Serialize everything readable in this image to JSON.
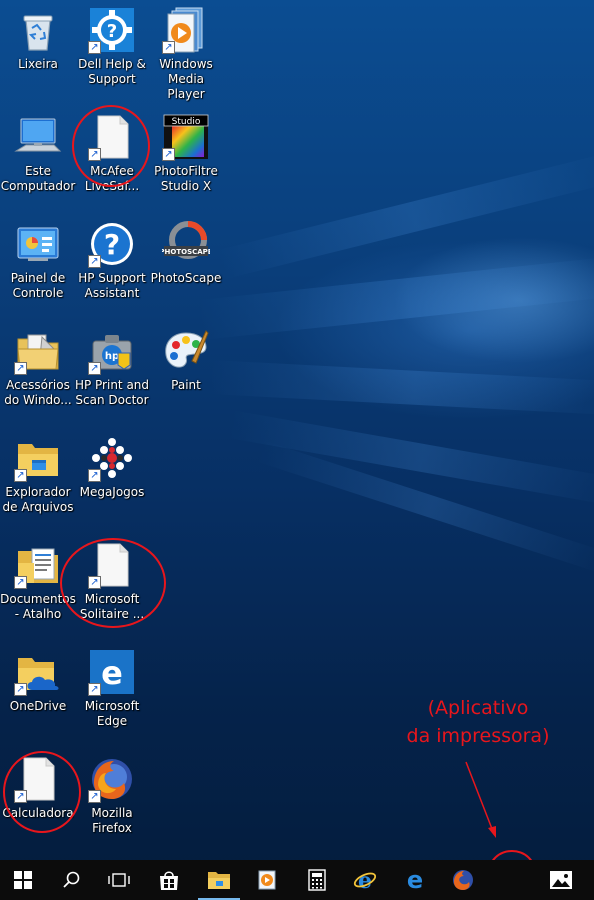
{
  "desktop": {
    "icons": [
      {
        "label": "Lixeira",
        "icon": "recycle-bin-icon"
      },
      {
        "label": "Dell Help & Support",
        "icon": "dell-help-icon"
      },
      {
        "label": "Windows Media Player",
        "icon": "media-player-icon"
      },
      {
        "label": "Este Computador",
        "icon": "computer-icon"
      },
      {
        "label": "McAfee LiveSaf...",
        "icon": "blank-file-icon"
      },
      {
        "label": "PhotoFiltre Studio X",
        "icon": "photofiltre-icon",
        "badge": "Studio"
      },
      {
        "label": "Painel de Controle",
        "icon": "control-panel-icon"
      },
      {
        "label": "HP Support Assistant",
        "icon": "hp-support-icon"
      },
      {
        "label": "PhotoScape",
        "icon": "photoscape-icon",
        "badge": "PHOTOSCAPE"
      },
      {
        "label": "Acessórios do Windo...",
        "icon": "accessories-folder-icon"
      },
      {
        "label": "HP Print and Scan Doctor",
        "icon": "hp-print-doctor-icon"
      },
      {
        "label": "Paint",
        "icon": "paint-icon"
      },
      {
        "label": "Explorador de Arquivos",
        "icon": "file-explorer-icon"
      },
      {
        "label": "MegaJogos",
        "icon": "megajogos-icon"
      },
      {
        "label": "Documentos - Atalho",
        "icon": "documents-folder-icon"
      },
      {
        "label": "Microsoft Solitaire ...",
        "icon": "blank-file-icon"
      },
      {
        "label": "OneDrive",
        "icon": "onedrive-icon"
      },
      {
        "label": "Microsoft Edge",
        "icon": "edge-icon"
      },
      {
        "label": "Calculadora",
        "icon": "blank-file-icon"
      },
      {
        "label": "Mozilla Firefox",
        "icon": "firefox-icon"
      }
    ],
    "annotation": {
      "line1": "(Aplicativo",
      "line2": "da impressora)",
      "color": "#e8161c"
    }
  },
  "taskbar": {
    "buttons": [
      {
        "name": "start-button",
        "icon": "windows-logo-icon"
      },
      {
        "name": "search-button",
        "icon": "search-icon"
      },
      {
        "name": "task-view-button",
        "icon": "task-view-icon"
      },
      {
        "name": "store-button",
        "icon": "store-icon"
      },
      {
        "name": "file-explorer-taskbar-button",
        "icon": "folder-icon"
      },
      {
        "name": "media-player-taskbar-button",
        "icon": "media-player-icon"
      },
      {
        "name": "calculator-taskbar-button",
        "icon": "calculator-icon"
      },
      {
        "name": "internet-explorer-taskbar-button",
        "icon": "ie-icon"
      },
      {
        "name": "edge-taskbar-button",
        "icon": "edge-icon"
      },
      {
        "name": "firefox-taskbar-button",
        "icon": "firefox-icon"
      },
      {
        "name": "printer-app-taskbar-button",
        "icon": "blank-icon"
      },
      {
        "name": "photos-taskbar-button",
        "icon": "photos-icon"
      }
    ]
  },
  "colors": {
    "wallpaper": "#0a3f7c",
    "taskbar": "#0c0c0c",
    "annotation": "#e8161c"
  }
}
